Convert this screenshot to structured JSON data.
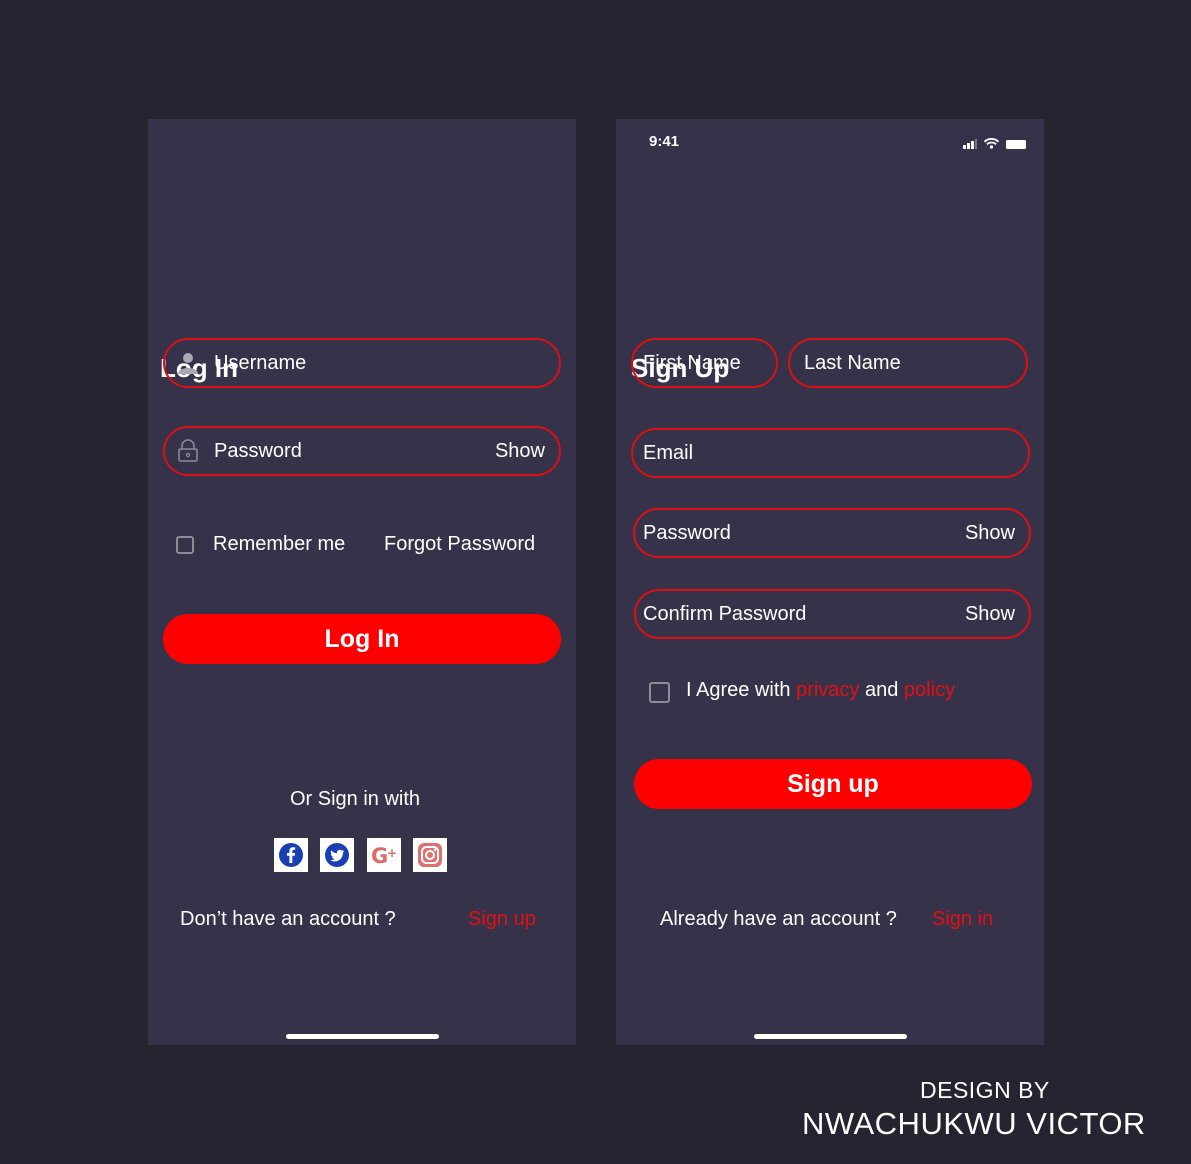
{
  "login": {
    "title": "Log In",
    "username_placeholder": "Username",
    "password_placeholder": "Password",
    "show_label": "Show",
    "remember_label": "Remember me",
    "forgot_label": "Forgot Password",
    "button_label": "Log In",
    "or_sign_in_with": "Or Sign in with",
    "no_account_text": "Don’t have an account ?",
    "signup_link": "Sign up",
    "social_icons": [
      "facebook-icon",
      "twitter-icon",
      "google-plus-icon",
      "instagram-icon"
    ]
  },
  "signup": {
    "status_time": "9:41",
    "title": "Sign Up",
    "first_name_placeholder": "First Name",
    "last_name_placeholder": "Last Name",
    "email_placeholder": "Email",
    "password_placeholder": "Password",
    "confirm_password_placeholder": "Confirm Password",
    "show_label": "Show",
    "agree_prefix": "I Agree with",
    "privacy_link": "privacy",
    "agree_and": "and",
    "policy_link": "policy",
    "button_label": "Sign up",
    "have_account_text": "Already have an account ?",
    "signin_link": "Sign in"
  },
  "credit": {
    "line1": "DESIGN BY",
    "line2": "NWACHUKWU VICTOR"
  },
  "colors": {
    "background": "#252431",
    "screen": "#35324a",
    "accent": "#ff0000",
    "field_border": "#dd0f12"
  }
}
